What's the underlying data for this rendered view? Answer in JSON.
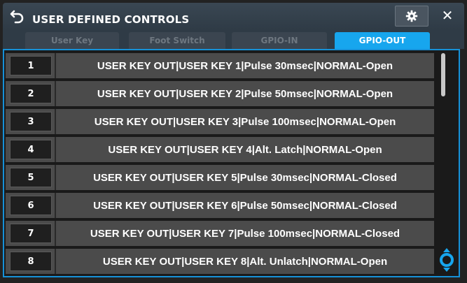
{
  "header": {
    "title": "USER DEFINED CONTROLS",
    "back_icon": "back-arrow-icon",
    "settings_icon": "gear-icon",
    "close_label": "✕"
  },
  "tabs": [
    {
      "label": "User Key",
      "active": false
    },
    {
      "label": "Foot Switch",
      "active": false
    },
    {
      "label": "GPIO-IN",
      "active": false
    },
    {
      "label": "GPIO-OUT",
      "active": true
    }
  ],
  "rows": [
    {
      "num": "1",
      "text": "USER KEY OUT|USER KEY 1|Pulse 30msec|NORMAL-Open"
    },
    {
      "num": "2",
      "text": "USER KEY OUT|USER KEY 2|Pulse 50msec|NORMAL-Open"
    },
    {
      "num": "3",
      "text": "USER KEY OUT|USER KEY 3|Pulse 100msec|NORMAL-Open"
    },
    {
      "num": "4",
      "text": "USER KEY OUT|USER KEY 4|Alt. Latch|NORMAL-Open"
    },
    {
      "num": "5",
      "text": "USER KEY OUT|USER KEY 5|Pulse 30msec|NORMAL-Closed"
    },
    {
      "num": "6",
      "text": "USER KEY OUT|USER KEY 6|Pulse 50msec|NORMAL-Closed"
    },
    {
      "num": "7",
      "text": "USER KEY OUT|USER KEY 7|Pulse 100msec|NORMAL-Closed"
    },
    {
      "num": "8",
      "text": "USER KEY OUT|USER KEY 8|Alt. Unlatch|NORMAL-Open"
    }
  ],
  "colors": {
    "accent": "#17a6ee",
    "row_bg": "#4b4b4b",
    "title_bg": "#2f3b46"
  }
}
